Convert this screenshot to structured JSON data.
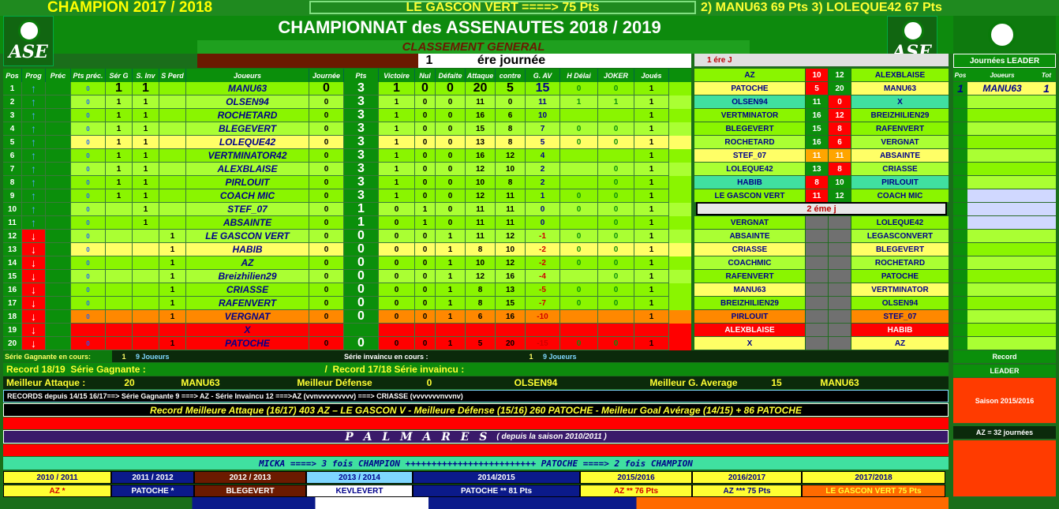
{
  "top": {
    "champion": "CHAMPION 2017 / 2018",
    "leader": "LE GASCON VERT ====>  75 Pts",
    "others": "2)  MANU63  69 Pts  3) LOLEQUE42  67 Pts"
  },
  "title": "CHAMPIONNAT des ASSENAUTES   2018 / 2019",
  "subtitle": "CLASSEMENT GENERAL",
  "journee": {
    "num": "1",
    "label": "ére journée"
  },
  "columns": [
    "Pos",
    "Prog",
    "Préc",
    "Pts préc.",
    "Sér G",
    "S. Inv",
    "S Perd",
    "Joueurs",
    "Journée",
    "Pts",
    "Victoire",
    "Nul",
    "Défaite",
    "Attaque",
    "contre",
    "G. AV",
    "H Délai",
    "JOKER",
    "Joués"
  ],
  "rows": [
    {
      "pos": "1",
      "prog": "↑",
      "prec": "",
      "ptsprec": "0",
      "serg": "1",
      "sinv": "1",
      "sperd": "",
      "joueur": "MANU63",
      "journee": "0",
      "pts": "3",
      "vic": "1",
      "nul": "0",
      "def": "0",
      "att": "20",
      "con": "5",
      "gav": "15",
      "hd": "0",
      "jok": "0",
      "joues": "1"
    },
    {
      "pos": "2",
      "prog": "↑",
      "prec": "",
      "ptsprec": "0",
      "serg": "1",
      "sinv": "1",
      "sperd": "",
      "joueur": "OLSEN94",
      "journee": "0",
      "pts": "3",
      "vic": "1",
      "nul": "0",
      "def": "0",
      "att": "11",
      "con": "0",
      "gav": "11",
      "hd": "1",
      "jok": "1",
      "joues": "1"
    },
    {
      "pos": "3",
      "prog": "↑",
      "prec": "",
      "ptsprec": "0",
      "serg": "1",
      "sinv": "1",
      "sperd": "",
      "joueur": "ROCHETARD",
      "journee": "0",
      "pts": "3",
      "vic": "1",
      "nul": "0",
      "def": "0",
      "att": "16",
      "con": "6",
      "gav": "10",
      "hd": "",
      "jok": "",
      "joues": "1"
    },
    {
      "pos": "4",
      "prog": "↑",
      "prec": "",
      "ptsprec": "0",
      "serg": "1",
      "sinv": "1",
      "sperd": "",
      "joueur": "BLEGEVERT",
      "journee": "0",
      "pts": "3",
      "vic": "1",
      "nul": "0",
      "def": "0",
      "att": "15",
      "con": "8",
      "gav": "7",
      "hd": "0",
      "jok": "0",
      "joues": "1"
    },
    {
      "pos": "5",
      "prog": "↑",
      "prec": "",
      "ptsprec": "0",
      "serg": "1",
      "sinv": "1",
      "sperd": "",
      "joueur": "LOLEQUE42",
      "journee": "0",
      "pts": "3",
      "vic": "1",
      "nul": "0",
      "def": "0",
      "att": "13",
      "con": "8",
      "gav": "5",
      "hd": "0",
      "jok": "0",
      "joues": "1"
    },
    {
      "pos": "6",
      "prog": "↑",
      "prec": "",
      "ptsprec": "0",
      "serg": "1",
      "sinv": "1",
      "sperd": "",
      "joueur": "VERTMINATOR42",
      "journee": "0",
      "pts": "3",
      "vic": "1",
      "nul": "0",
      "def": "0",
      "att": "16",
      "con": "12",
      "gav": "4",
      "hd": "",
      "jok": "",
      "joues": "1"
    },
    {
      "pos": "7",
      "prog": "↑",
      "prec": "",
      "ptsprec": "0",
      "serg": "1",
      "sinv": "1",
      "sperd": "",
      "joueur": "ALEXBLAISE",
      "journee": "0",
      "pts": "3",
      "vic": "1",
      "nul": "0",
      "def": "0",
      "att": "12",
      "con": "10",
      "gav": "2",
      "hd": "",
      "jok": "0",
      "joues": "1"
    },
    {
      "pos": "8",
      "prog": "↑",
      "prec": "",
      "ptsprec": "0",
      "serg": "1",
      "sinv": "1",
      "sperd": "",
      "joueur": "PIRLOUIT",
      "journee": "0",
      "pts": "3",
      "vic": "1",
      "nul": "0",
      "def": "0",
      "att": "10",
      "con": "8",
      "gav": "2",
      "hd": "",
      "jok": "0",
      "joues": "1"
    },
    {
      "pos": "9",
      "prog": "↑",
      "prec": "",
      "ptsprec": "0",
      "serg": "1",
      "sinv": "1",
      "sperd": "",
      "joueur": "COACH MIC",
      "journee": "0",
      "pts": "3",
      "vic": "1",
      "nul": "0",
      "def": "0",
      "att": "12",
      "con": "11",
      "gav": "1",
      "hd": "0",
      "jok": "0",
      "joues": "1"
    },
    {
      "pos": "10",
      "prog": "↑",
      "prec": "",
      "ptsprec": "0",
      "serg": "",
      "sinv": "1",
      "sperd": "",
      "joueur": "STEF_07",
      "journee": "0",
      "pts": "1",
      "vic": "0",
      "nul": "1",
      "def": "0",
      "att": "11",
      "con": "11",
      "gav": "0",
      "hd": "0",
      "jok": "0",
      "joues": "1"
    },
    {
      "pos": "11",
      "prog": "↑",
      "prec": "",
      "ptsprec": "0",
      "serg": "",
      "sinv": "1",
      "sperd": "",
      "joueur": "ABSAINTE",
      "journee": "0",
      "pts": "1",
      "vic": "0",
      "nul": "1",
      "def": "0",
      "att": "11",
      "con": "11",
      "gav": "0",
      "hd": "",
      "jok": "0",
      "joues": "1"
    },
    {
      "pos": "12",
      "prog": "↓",
      "prec": "",
      "ptsprec": "0",
      "serg": "",
      "sinv": "",
      "sperd": "1",
      "joueur": "LE GASCON VERT",
      "journee": "0",
      "pts": "0",
      "vic": "0",
      "nul": "0",
      "def": "1",
      "att": "11",
      "con": "12",
      "gav": "-1",
      "hd": "0",
      "jok": "0",
      "joues": "1"
    },
    {
      "pos": "13",
      "prog": "↓",
      "prec": "",
      "ptsprec": "0",
      "serg": "",
      "sinv": "",
      "sperd": "1",
      "joueur": "HABIB",
      "journee": "0",
      "pts": "0",
      "vic": "0",
      "nul": "0",
      "def": "1",
      "att": "8",
      "con": "10",
      "gav": "-2",
      "hd": "0",
      "jok": "0",
      "joues": "1"
    },
    {
      "pos": "14",
      "prog": "↓",
      "prec": "",
      "ptsprec": "0",
      "serg": "",
      "sinv": "",
      "sperd": "1",
      "joueur": "AZ",
      "journee": "0",
      "pts": "0",
      "vic": "0",
      "nul": "0",
      "def": "1",
      "att": "10",
      "con": "12",
      "gav": "-2",
      "hd": "0",
      "jok": "0",
      "joues": "1"
    },
    {
      "pos": "15",
      "prog": "↓",
      "prec": "",
      "ptsprec": "0",
      "serg": "",
      "sinv": "",
      "sperd": "1",
      "joueur": "Breizhilien29",
      "journee": "0",
      "pts": "0",
      "vic": "0",
      "nul": "0",
      "def": "1",
      "att": "12",
      "con": "16",
      "gav": "-4",
      "hd": "",
      "jok": "0",
      "joues": "1"
    },
    {
      "pos": "16",
      "prog": "↓",
      "prec": "",
      "ptsprec": "0",
      "serg": "",
      "sinv": "",
      "sperd": "1",
      "joueur": "CRIASSE",
      "journee": "0",
      "pts": "0",
      "vic": "0",
      "nul": "0",
      "def": "1",
      "att": "8",
      "con": "13",
      "gav": "-5",
      "hd": "0",
      "jok": "0",
      "joues": "1"
    },
    {
      "pos": "17",
      "prog": "↓",
      "prec": "",
      "ptsprec": "0",
      "serg": "",
      "sinv": "",
      "sperd": "1",
      "joueur": "RAFENVERT",
      "journee": "0",
      "pts": "0",
      "vic": "0",
      "nul": "0",
      "def": "1",
      "att": "8",
      "con": "15",
      "gav": "-7",
      "hd": "0",
      "jok": "0",
      "joues": "1"
    },
    {
      "pos": "18",
      "prog": "↓",
      "prec": "",
      "ptsprec": "0",
      "serg": "",
      "sinv": "",
      "sperd": "1",
      "joueur": "VERGNAT",
      "journee": "0",
      "pts": "0",
      "vic": "0",
      "nul": "0",
      "def": "1",
      "att": "6",
      "con": "16",
      "gav": "-10",
      "hd": "",
      "jok": "",
      "joues": "1"
    },
    {
      "pos": "19",
      "prog": "↓",
      "prec": "",
      "ptsprec": "",
      "serg": "",
      "sinv": "",
      "sperd": "",
      "joueur": "X",
      "journee": "",
      "pts": "",
      "vic": "",
      "nul": "",
      "def": "",
      "att": "",
      "con": "",
      "gav": "",
      "hd": "",
      "jok": "",
      "joues": ""
    },
    {
      "pos": "20",
      "prog": "↓",
      "prec": "",
      "ptsprec": "0",
      "serg": "",
      "sinv": "",
      "sperd": "1",
      "joueur": "PATOCHE",
      "journee": "0",
      "pts": "0",
      "vic": "0",
      "nul": "0",
      "def": "1",
      "att": "5",
      "con": "20",
      "gav": "-15",
      "hd": "0",
      "jok": "0",
      "joues": "1"
    }
  ],
  "matches": {
    "j1_label": "1 ére J",
    "j1": [
      {
        "home": "AZ",
        "h": "10",
        "a": "12",
        "away": "ALEXBLAISE"
      },
      {
        "home": "PATOCHE",
        "h": "5",
        "a": "20",
        "away": "MANU63"
      },
      {
        "home": "OLSEN94",
        "h": "11",
        "a": "0",
        "away": "X"
      },
      {
        "home": "VERTMINATOR",
        "h": "16",
        "a": "12",
        "away": "BREIZHILIEN29"
      },
      {
        "home": "BLEGEVERT",
        "h": "15",
        "a": "8",
        "away": "RAFENVERT"
      },
      {
        "home": "ROCHETARD",
        "h": "16",
        "a": "6",
        "away": "VERGNAT"
      },
      {
        "home": "STEF_07",
        "h": "11",
        "a": "11",
        "away": "ABSAINTE"
      },
      {
        "home": "LOLEQUE42",
        "h": "13",
        "a": "8",
        "away": "CRIASSE"
      },
      {
        "home": "HABIB",
        "h": "8",
        "a": "10",
        "away": "PIRLOUIT"
      },
      {
        "home": "LE GASCON VERT",
        "h": "11",
        "a": "12",
        "away": "COACH MIC"
      }
    ],
    "j2_label": "2 éme j",
    "j2": [
      {
        "home": "VERGNAT",
        "away": "LOLEQUE42"
      },
      {
        "home": "ABSAINTE",
        "away": "LEGASCONVERT"
      },
      {
        "home": "CRIASSE",
        "away": "BLEGEVERT"
      },
      {
        "home": "COACHMIC",
        "away": "ROCHETARD"
      },
      {
        "home": "RAFENVERT",
        "away": "PATOCHE"
      },
      {
        "home": "MANU63",
        "away": "VERTMINATOR"
      },
      {
        "home": "BREIZHILIEN29",
        "away": "OLSEN94"
      },
      {
        "home": "PIRLOUIT",
        "away": "STEF_07"
      },
      {
        "home": "ALEXBLAISE",
        "away": "HABIB"
      },
      {
        "home": "X",
        "away": "AZ"
      }
    ]
  },
  "leader_panel": {
    "title": "Journées LEADER",
    "cols": [
      "Pos",
      "Joueurs",
      "Tot"
    ],
    "first": {
      "pos": "1",
      "joueur": "MANU63",
      "tot": "1"
    },
    "record": "Record",
    "leader": "LEADER",
    "saison": "Saison 2015/2016",
    "az": "AZ = 32 journées"
  },
  "series": {
    "gagnante_label": "Série Gagnante en cours:",
    "gagnante_val": "1",
    "gagnante_j": "9 Joueurs",
    "invaincu_label": "Série invaincu en cours :",
    "invaincu_val": "1",
    "invaincu_j": "9 Joueurs"
  },
  "record_line": "Record 18/19  Série Gagnante :                                                                    /  Record 17/18 Série invaincu :",
  "best": {
    "att_label": "Meilleur Attaque :",
    "att_val": "20",
    "att_name": "MANU63",
    "def_label": "Meilleur Défense",
    "def_val": "0",
    "def_name": "OLSEN94",
    "gav_label": "Meilleur G. Average",
    "gav_val": "15",
    "gav_name": "MANU63"
  },
  "records_line": "RECORDS depuis 14/15  16/17==> Série Gagnante 9 ===> AZ - Série Invaincu 12 ===>AZ (vvnvvvvvvvvv) ===> CRIASSE (vvvvvvvnvvnv)",
  "records_line2": "Record Meilleure Attaque (16/17) 403 AZ – LE GASCON V - Meilleure Défense  (15/16) 260 PATOCHE  - Meilleur Goal Avérage (14/15) + 86 PATOCHE",
  "palmares": "P A L M A R E S",
  "palmares_sub": "( depuis la saison 2010/2011 )",
  "champions_line": "MICKA ====> 3 fois CHAMPION +++++++++++++++++++++++++ PATOCHE ====> 2 fois CHAMPION",
  "seasons": [
    {
      "year": "2010 / 2011",
      "winner": "AZ *"
    },
    {
      "year": "2011 / 2012",
      "winner": "PATOCHE *"
    },
    {
      "year": "2012 / 2013",
      "winner": "BLEGEVERT"
    },
    {
      "year": "2013 / 2014",
      "winner": "KEVLEVERT"
    },
    {
      "year": "2014/2015",
      "winner": "PATOCHE **  81 Pts"
    },
    {
      "year": "2015/2016",
      "winner": "AZ ** 76 Pts"
    },
    {
      "year": "2016/2017",
      "winner": "AZ  ***   75 Pts"
    },
    {
      "year": "2017/2018",
      "winner": "LE GASCON VERT 75 Pts"
    }
  ]
}
